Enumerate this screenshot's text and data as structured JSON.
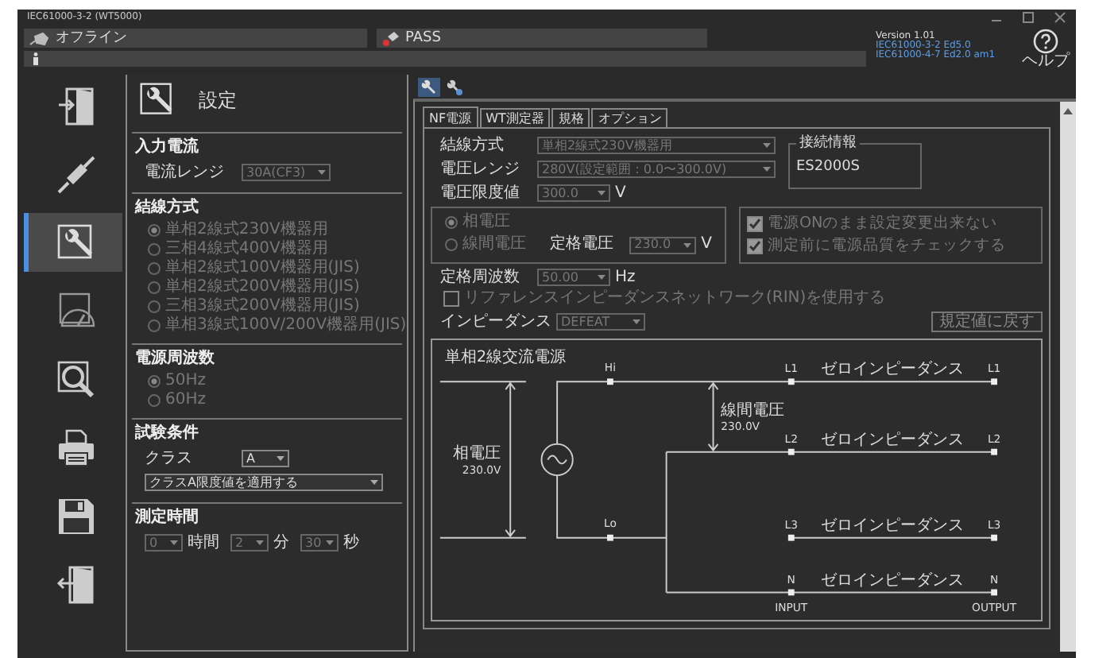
{
  "window": {
    "title": "IEC61000-3-2 (WT5000)"
  },
  "status": {
    "connection": "オフライン",
    "result": "PASS"
  },
  "version": {
    "label": "Version 1.01",
    "standards": [
      "IEC61000-3-2 Ed5.0",
      "IEC61000-4-7 Ed2.0 am1"
    ]
  },
  "help": {
    "label": "ヘルプ"
  },
  "nav": [
    {
      "kind": "import",
      "selected": false
    },
    {
      "kind": "connect",
      "selected": false
    },
    {
      "kind": "settings",
      "selected": true
    },
    {
      "kind": "meter",
      "selected": false
    },
    {
      "kind": "inspect",
      "selected": false
    },
    {
      "kind": "print",
      "selected": false
    },
    {
      "kind": "save",
      "selected": false
    },
    {
      "kind": "exit",
      "selected": false
    }
  ],
  "settings": {
    "title": "設定",
    "input_current": {
      "heading": "入力電流",
      "label": "電流レンジ",
      "value": "30A(CF3)"
    },
    "wiring": {
      "heading": "結線方式",
      "options": [
        {
          "label": "単相2線式230V機器用",
          "selected": true
        },
        {
          "label": "三相4線式400V機器用",
          "selected": false
        },
        {
          "label": "単相2線式100V機器用(JIS)",
          "selected": false
        },
        {
          "label": "単相2線式200V機器用(JIS)",
          "selected": false
        },
        {
          "label": "三相3線式200V機器用(JIS)",
          "selected": false
        },
        {
          "label": "単相3線式100V/200V機器用(JIS)",
          "selected": false
        }
      ]
    },
    "frequency": {
      "heading": "電源周波数",
      "options": [
        {
          "label": "50Hz",
          "selected": true
        },
        {
          "label": "60Hz",
          "selected": false
        }
      ]
    },
    "test_conditions": {
      "heading": "試験条件",
      "class_label": "クラス",
      "class_value": "A",
      "limit_value": "クラスA限度値を適用する"
    },
    "duration": {
      "heading": "測定時間",
      "fields": [
        {
          "value": "0",
          "unit": "時間"
        },
        {
          "value": "2",
          "unit": "分"
        },
        {
          "value": "30",
          "unit": "秒"
        }
      ]
    }
  },
  "tabs": [
    {
      "label": "NF電源",
      "selected": true
    },
    {
      "label": "WT測定器",
      "selected": false
    },
    {
      "label": "規格",
      "selected": false
    },
    {
      "label": "オプション",
      "selected": false
    }
  ],
  "form": {
    "wiring": {
      "label": "結線方式",
      "value": "単相2線式230V機器用"
    },
    "connection_info": {
      "heading": "接続情報",
      "value": "ES2000S"
    },
    "voltage_range": {
      "label": "電圧レンジ",
      "value": "280V(設定範囲：0.0〜300.0V)"
    },
    "voltage_limit": {
      "label": "電圧限度値",
      "value": "300.0",
      "unit": "V"
    },
    "voltage_mode": [
      {
        "label": "相電圧",
        "selected": true
      },
      {
        "label": "線間電圧",
        "selected": false
      }
    ],
    "rated_voltage": {
      "label": "定格電圧",
      "value": "230.0",
      "unit": "V"
    },
    "checks": [
      {
        "label": "電源ONのまま設定変更出来ない",
        "checked": true
      },
      {
        "label": "測定前に電源品質をチェックする",
        "checked": true
      }
    ],
    "rated_frequency": {
      "label": "定格周波数",
      "value": "50.00",
      "unit": "Hz"
    },
    "rin": {
      "label": "リファレンスインピーダンスネットワーク(RIN)を使用する",
      "checked": false
    },
    "impedance": {
      "label": "インピーダンス",
      "value": "DEFEAT"
    },
    "reset_button": "規定値に戻す"
  },
  "diagram": {
    "source": "単相2線交流電源",
    "phase_label": "相電圧",
    "phase_value": "230.0V",
    "line_label": "線間電圧",
    "line_value": "230.0V",
    "hi": "Hi",
    "lo": "Lo",
    "lines": [
      {
        "input": "L1",
        "output": "L1",
        "label": "ゼロインピーダンス"
      },
      {
        "input": "L2",
        "output": "L2",
        "label": "ゼロインピーダンス"
      },
      {
        "input": "L3",
        "output": "L3",
        "label": "ゼロインピーダンス"
      },
      {
        "input": "N",
        "output": "N",
        "label": "ゼロインピーダンス"
      }
    ],
    "input_label": "INPUT",
    "output_label": "OUTPUT"
  }
}
